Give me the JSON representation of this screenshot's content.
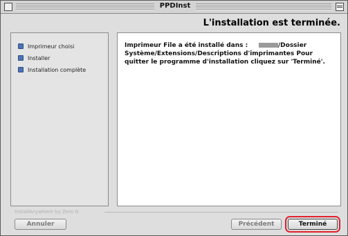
{
  "window": {
    "title": "PPDInst"
  },
  "header": {
    "text": "L'installation est terminée."
  },
  "steps": [
    {
      "label": "Imprimeur choisi",
      "state": "done"
    },
    {
      "label": "Installer",
      "state": "done"
    },
    {
      "label": "Installation complète",
      "state": "current"
    }
  ],
  "content": {
    "message_part1": "Imprimeur File a été installé dans :",
    "message_part2": "/Dossier Système/Extensions/Descriptions d'imprimantes  Pour quitter le programme d'installation cliquez sur 'Terminé'."
  },
  "branding": {
    "text": "InstallAnywhere by Zero G"
  },
  "buttons": {
    "cancel": "Annuler",
    "previous": "Précédent",
    "finish": "Terminé"
  },
  "colors": {
    "highlight_outline": "#e0202a",
    "step_bullet": "#4f72b0"
  }
}
